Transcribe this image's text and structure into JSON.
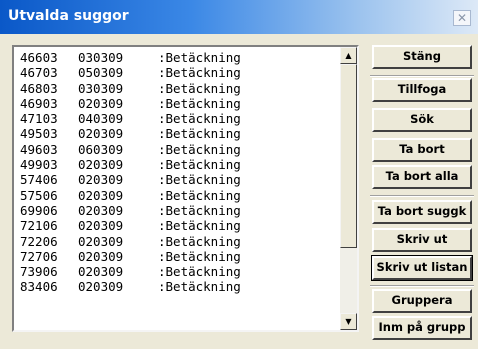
{
  "window": {
    "title": "Utvalda suggor",
    "close_symbol": "✕"
  },
  "list": {
    "rows": [
      {
        "id": "46603",
        "date": "030309",
        "status": ":Betäckning"
      },
      {
        "id": "46703",
        "date": "050309",
        "status": ":Betäckning"
      },
      {
        "id": "46803",
        "date": "030309",
        "status": ":Betäckning"
      },
      {
        "id": "46903",
        "date": "020309",
        "status": ":Betäckning"
      },
      {
        "id": "47103",
        "date": "040309",
        "status": ":Betäckning"
      },
      {
        "id": "49503",
        "date": "020309",
        "status": ":Betäckning"
      },
      {
        "id": "49603",
        "date": "060309",
        "status": ":Betäckning"
      },
      {
        "id": "49903",
        "date": "020309",
        "status": ":Betäckning"
      },
      {
        "id": "57406",
        "date": "020309",
        "status": ":Betäckning"
      },
      {
        "id": "57506",
        "date": "020309",
        "status": ":Betäckning"
      },
      {
        "id": "69906",
        "date": "020309",
        "status": ":Betäckning"
      },
      {
        "id": "72106",
        "date": "020309",
        "status": ":Betäckning"
      },
      {
        "id": "72206",
        "date": "020309",
        "status": ":Betäckning"
      },
      {
        "id": "72706",
        "date": "020309",
        "status": ":Betäckning"
      },
      {
        "id": "73906",
        "date": "020309",
        "status": ":Betäckning"
      },
      {
        "id": "83406",
        "date": "020309",
        "status": ":Betäckning"
      }
    ],
    "scroll_up_symbol": "▲",
    "scroll_down_symbol": "▼"
  },
  "buttons": {
    "stang": "Stäng",
    "tillfoga": "Tillfoga",
    "sok": "Sök",
    "ta_bort": "Ta bort",
    "ta_bort_alla": "Ta bort alla",
    "ta_bort_suggk": "Ta bort suggk",
    "skriv_ut": "Skriv ut",
    "skriv_ut_listan": "Skriv ut listan",
    "gruppera": "Gruppera",
    "inm_pa_grupp": "Inm på grupp"
  }
}
